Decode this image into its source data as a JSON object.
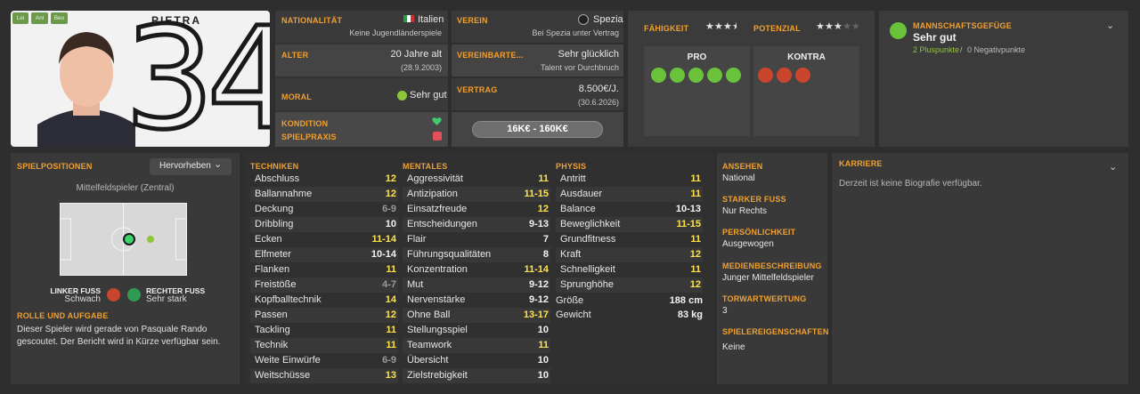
{
  "player": {
    "name": "PIETRA",
    "number": "34",
    "roles": [
      "Lei",
      "Anl",
      "Beo"
    ]
  },
  "info": {
    "nationality_label": "NATIONALITÄT",
    "nationality": "Italien",
    "youth": "Keine Jugendländerspiele",
    "age_label": "ALTER",
    "age": "20 Jahre alt",
    "dob": "(28.9.2003)",
    "morale_label": "MORAL",
    "morale": "Sehr gut",
    "condition_label": "KONDITION",
    "match_label": "SPIELPRAXIS"
  },
  "club": {
    "club_label": "VEREIN",
    "club": "Spezia",
    "contract_note": "Bei Spezia unter Vertrag",
    "agreed_label": "VEREINBARTE...",
    "agreed": "Sehr glücklich",
    "agreed_note": "Talent vor Durchbruch",
    "contract_label": "VERTRAG",
    "wage": "8.500€/J.",
    "expiry": "(30.6.2026)",
    "value": "16K€ - 160K€"
  },
  "ability": {
    "ability_label": "FÄHIGKEIT",
    "potential_label": "POTENZIAL",
    "ability_stars": 3.5,
    "potential_stars": 3,
    "pro_label": "PRO",
    "contra_label": "KONTRA"
  },
  "cohesion": {
    "title": "MANNSCHAFTSGEFÜGE",
    "value": "Sehr gut",
    "plus": "2 Pluspunkte",
    "sep": "/",
    "minus": "0 Negativpunkte"
  },
  "positions": {
    "title": "SPIELPOSITIONEN",
    "dropdown": "Hervorheben",
    "role": "Mittelfeldspieler (Zentral)",
    "left_foot_label": "LINKER FUSS",
    "left_foot": "Schwach",
    "right_foot_label": "RECHTER FUSS",
    "right_foot": "Sehr stark",
    "role_title": "ROLLE UND AUFGABE",
    "role_text": "Dieser Spieler wird gerade von Pasquale Rando gescoutet. Der Bericht wird in Kürze verfügbar sein."
  },
  "technical": {
    "title": "TECHNIKEN",
    "rows": [
      {
        "name": "Abschluss",
        "value": "12"
      },
      {
        "name": "Ballannahme",
        "value": "12"
      },
      {
        "name": "Deckung",
        "value": "6-9"
      },
      {
        "name": "Dribbling",
        "value": "10"
      },
      {
        "name": "Ecken",
        "value": "11-14"
      },
      {
        "name": "Elfmeter",
        "value": "10-14"
      },
      {
        "name": "Flanken",
        "value": "11"
      },
      {
        "name": "Freistöße",
        "value": "4-7"
      },
      {
        "name": "Kopfballtechnik",
        "value": "14"
      },
      {
        "name": "Passen",
        "value": "12"
      },
      {
        "name": "Tackling",
        "value": "11"
      },
      {
        "name": "Technik",
        "value": "11"
      },
      {
        "name": "Weite Einwürfe",
        "value": "6-9"
      },
      {
        "name": "Weitschüsse",
        "value": "13"
      }
    ]
  },
  "mental": {
    "title": "MENTALES",
    "rows": [
      {
        "name": "Aggressivität",
        "value": "11"
      },
      {
        "name": "Antizipation",
        "value": "11-15"
      },
      {
        "name": "Einsatzfreude",
        "value": "12"
      },
      {
        "name": "Entscheidungen",
        "value": "9-13"
      },
      {
        "name": "Flair",
        "value": "7"
      },
      {
        "name": "Führungsqualitäten",
        "value": "8"
      },
      {
        "name": "Konzentration",
        "value": "11-14"
      },
      {
        "name": "Mut",
        "value": "9-12"
      },
      {
        "name": "Nervenstärke",
        "value": "9-12"
      },
      {
        "name": "Ohne Ball",
        "value": "13-17"
      },
      {
        "name": "Stellungsspiel",
        "value": "10"
      },
      {
        "name": "Teamwork",
        "value": "11"
      },
      {
        "name": "Übersicht",
        "value": "10"
      },
      {
        "name": "Zielstrebigkeit",
        "value": "10"
      }
    ]
  },
  "physical": {
    "title": "PHYSIS",
    "rows": [
      {
        "name": "Antritt",
        "value": "11"
      },
      {
        "name": "Ausdauer",
        "value": "11"
      },
      {
        "name": "Balance",
        "value": "10-13"
      },
      {
        "name": "Beweglichkeit",
        "value": "11-15"
      },
      {
        "name": "Grundfitness",
        "value": "11"
      },
      {
        "name": "Kraft",
        "value": "12"
      },
      {
        "name": "Schnelligkeit",
        "value": "11"
      },
      {
        "name": "Sprunghöhe",
        "value": "12"
      }
    ],
    "height_label": "Größe",
    "height": "188 cm",
    "weight_label": "Gewicht",
    "weight": "83 kg"
  },
  "details": {
    "appearance_label": "ANSEHEN",
    "appearance": "National",
    "foot_label": "STARKER FUSS",
    "foot": "Nur Rechts",
    "personality_label": "PERSÖNLICHKEIT",
    "personality": "Ausgewogen",
    "media_label": "MEDIENBESCHREIBUNG",
    "media": "Junger Mittelfeldspieler",
    "gk_label": "TORWARTWERTUNG",
    "gk": "3",
    "traits_label": "SPIELEREIGENSCHAFTEN",
    "traits": "Keine"
  },
  "career": {
    "title": "KARRIERE",
    "text": "Derzeit ist keine Biografie verfügbar."
  },
  "colors": {
    "accent": "#f0a030",
    "highlight": "#ffe34d",
    "good": "#6ac23a",
    "bad": "#c9452d"
  }
}
